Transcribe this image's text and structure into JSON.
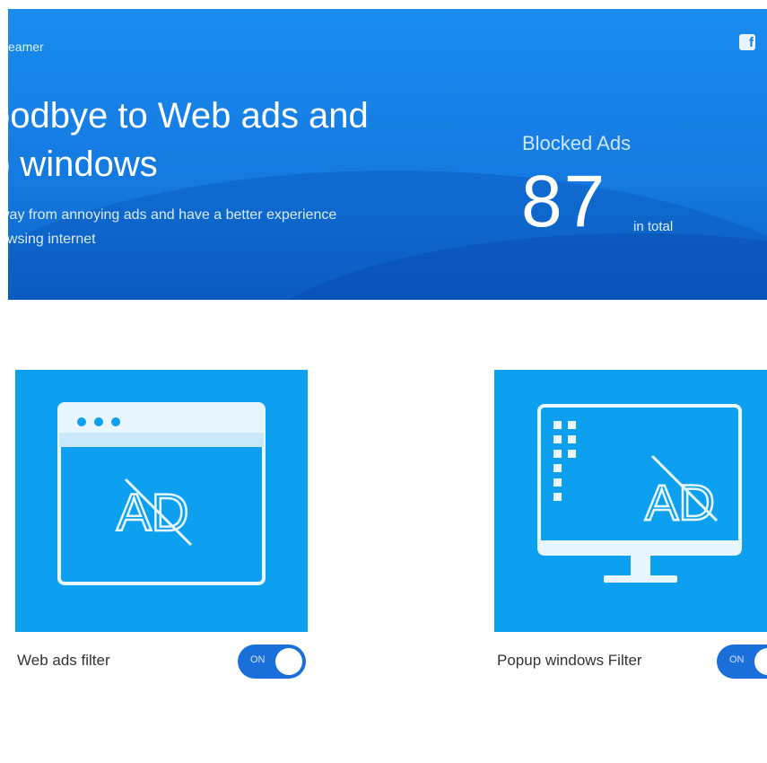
{
  "banner": {
    "app_name": "eamer",
    "social_icon": "facebook-icon",
    "headline_line1": "oodbye to Web ads and",
    "headline_line2": "p windows",
    "subline_line1": "way from annoying ads and have a better experience",
    "subline_line2": "owsing internet",
    "blocked_label": "Blocked Ads",
    "blocked_count": "87",
    "blocked_unit": "in total"
  },
  "filters": [
    {
      "label": "Web ads filter",
      "icon": "browser-ad-block-icon",
      "toggle_text": "ON",
      "enabled": true
    },
    {
      "label": "Popup windows Filter",
      "icon": "monitor-ad-block-icon",
      "toggle_text": "ON",
      "enabled": true
    }
  ],
  "colors": {
    "banner_blue": "#1479e0",
    "card_blue": "#0da0f0",
    "toggle_blue": "#1a6fdb"
  }
}
